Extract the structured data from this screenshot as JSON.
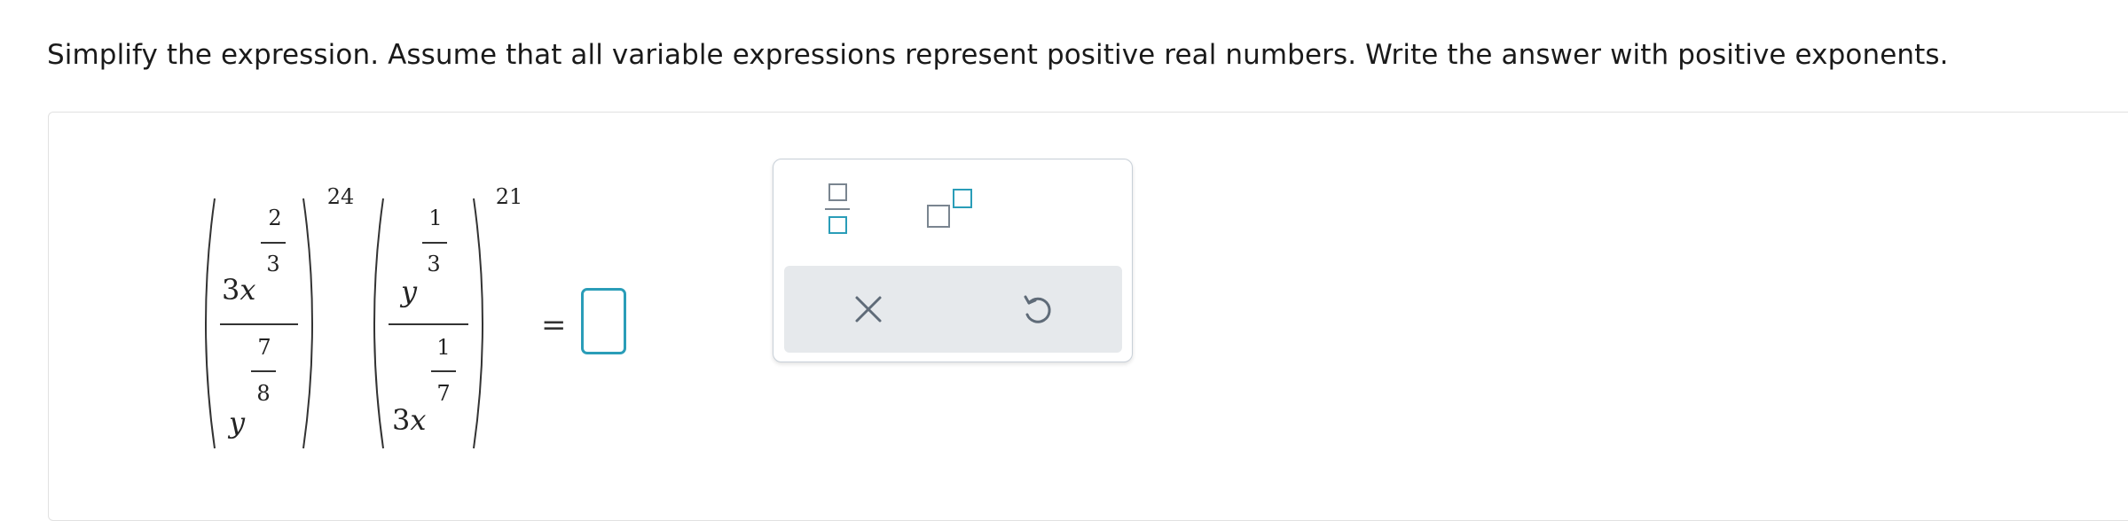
{
  "instructions": "Simplify the expression. Assume that all variable expressions represent positive real numbers. Write the answer with positive exponents.",
  "expression": {
    "term1": {
      "numerator_coef": "3",
      "numerator_var": "x",
      "numerator_exp_num": "2",
      "numerator_exp_den": "3",
      "denominator_var": "y",
      "denominator_exp_num": "7",
      "denominator_exp_den": "8",
      "outer_exponent": "24"
    },
    "term2": {
      "numerator_var": "y",
      "numerator_exp_num": "1",
      "numerator_exp_den": "3",
      "denominator_coef": "3",
      "denominator_var": "x",
      "denominator_exp_num": "1",
      "denominator_exp_den": "7",
      "outer_exponent": "21"
    },
    "equals": "="
  },
  "answer": {
    "value": ""
  },
  "toolbar": {
    "tools": [
      {
        "name": "fraction",
        "icon": "fraction-icon"
      },
      {
        "name": "exponent",
        "icon": "exponent-icon"
      }
    ],
    "actions": [
      {
        "name": "clear",
        "icon": "close-icon"
      },
      {
        "name": "undo",
        "icon": "undo-icon"
      }
    ]
  },
  "colors": {
    "accent": "#2a9db8",
    "toolbar_border": "#c8d0d8",
    "action_bg": "#e6e9ec",
    "icon_gray": "#5f6b78"
  }
}
